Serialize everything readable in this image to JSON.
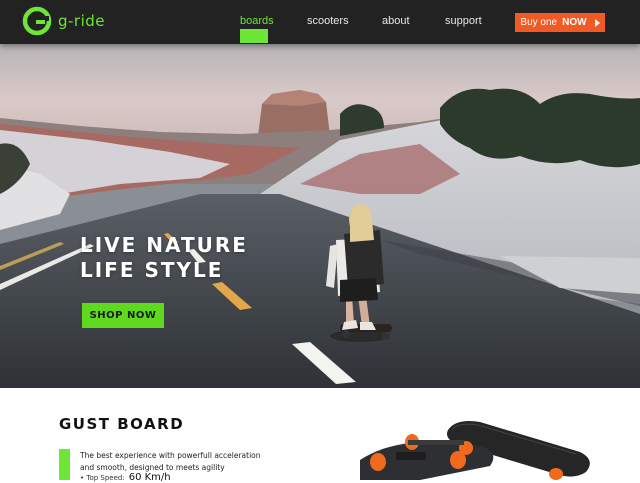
{
  "nav": {
    "logo_text": "g-ride",
    "links": [
      {
        "label": "boards",
        "active": true
      },
      {
        "label": "scooters",
        "active": false
      },
      {
        "label": "about",
        "active": false
      },
      {
        "label": "support",
        "active": false
      }
    ],
    "cta": {
      "label": "Buy one",
      "label_strong": "NOW"
    }
  },
  "hero": {
    "heading_line1": "LIVE NATURE",
    "heading_line2": "LIFE STYLE",
    "button": "SHOP NOW"
  },
  "product": {
    "title": "GUST BOARD",
    "description": "The best experience with powerfull acceleration and smooth, designed to meets agility",
    "spec_label": "• Top Speed:",
    "spec_value": "60 Km/h"
  },
  "colors": {
    "accent_green": "#6ee637",
    "cta_orange": "#f15a24",
    "nav_bg": "#222222"
  }
}
